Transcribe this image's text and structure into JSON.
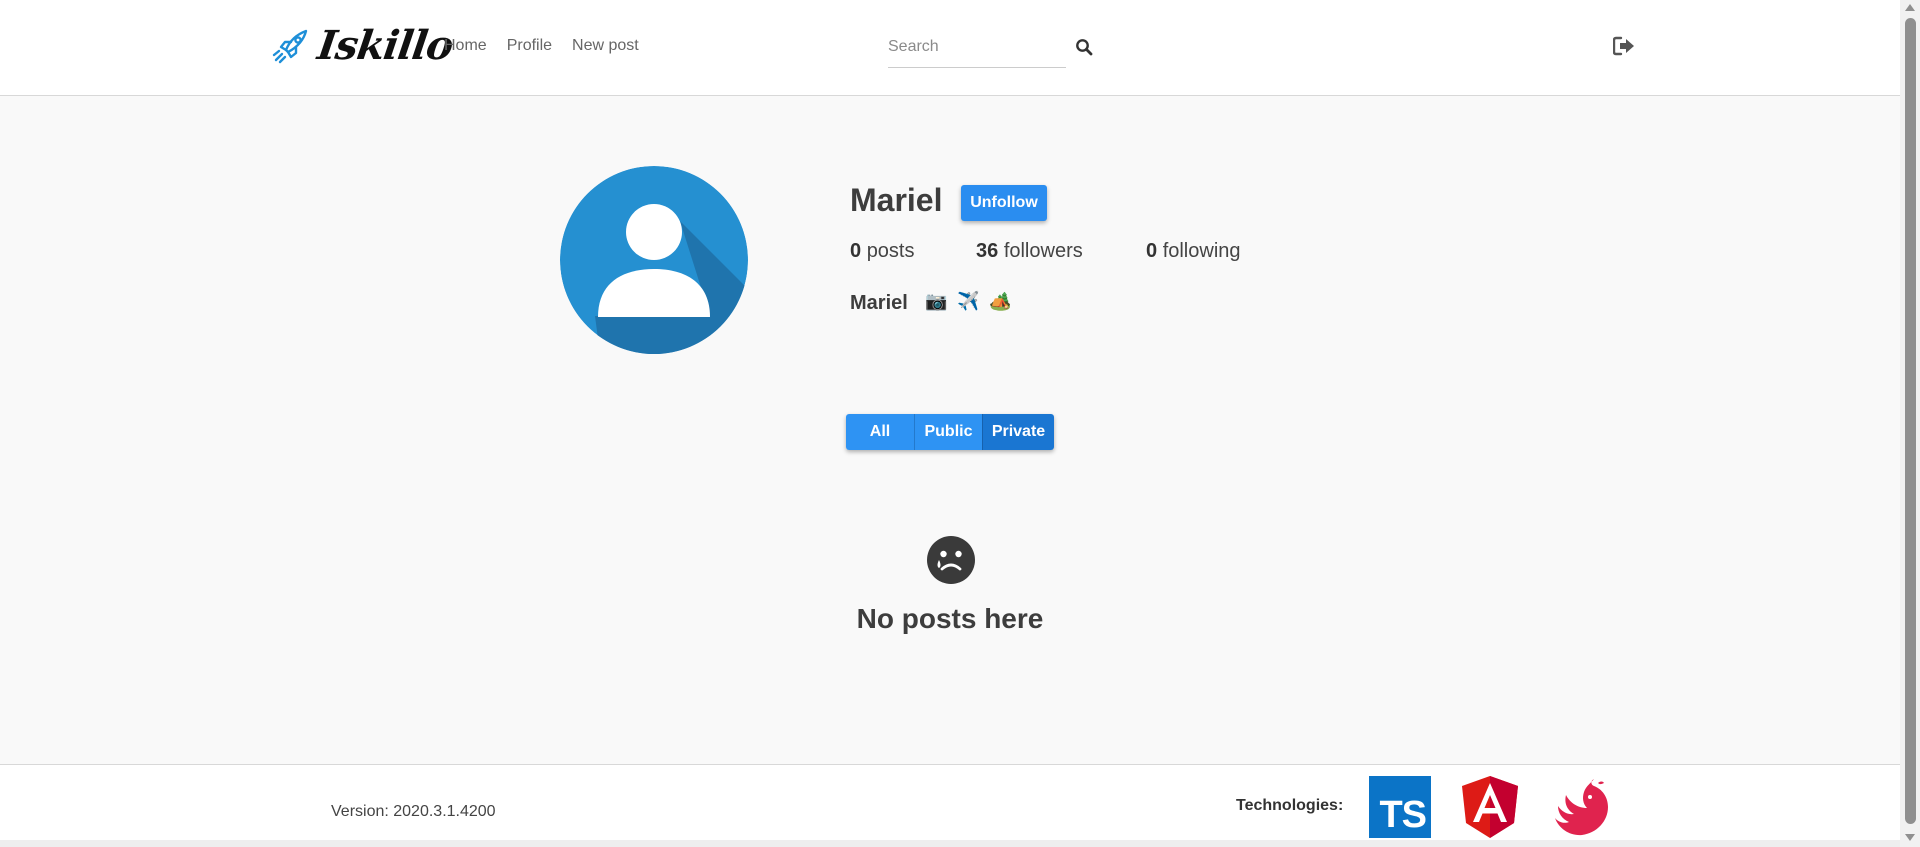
{
  "header": {
    "brand_name": "Iskillo",
    "nav": [
      {
        "label": "Home"
      },
      {
        "label": "Profile"
      },
      {
        "label": "New post"
      }
    ],
    "search": {
      "placeholder": "Search",
      "value": ""
    },
    "icons": {
      "logo": "rocket-icon",
      "search": "search-icon",
      "logout": "logout-icon"
    }
  },
  "profile": {
    "username": "Mariel",
    "follow_label": "Unfollow",
    "stats": {
      "posts_count": "0",
      "posts_label": "posts",
      "followers_count": "36",
      "followers_label": "followers",
      "following_count": "0",
      "following_label": "following"
    },
    "bio_name": "Mariel",
    "bio_emojis": "📷 ✈️ 🏕️",
    "avatar_icon": "user-avatar-icon"
  },
  "filters": {
    "tabs": [
      {
        "label": "All"
      },
      {
        "label": "Public"
      },
      {
        "label": "Private"
      }
    ],
    "active": "Private"
  },
  "empty_state": {
    "icon": "sad-face-icon",
    "message": "No posts here"
  },
  "footer": {
    "version": "Version: 2020.3.1.4200",
    "tech_label": "Technologies:",
    "ts_text": "TS",
    "technologies": [
      "typescript-logo",
      "angular-logo",
      "nestjs-logo"
    ]
  },
  "colors": {
    "accent": "#2a8df0",
    "avatar_bg": "#2590d1",
    "text": "#3d3d3d"
  }
}
